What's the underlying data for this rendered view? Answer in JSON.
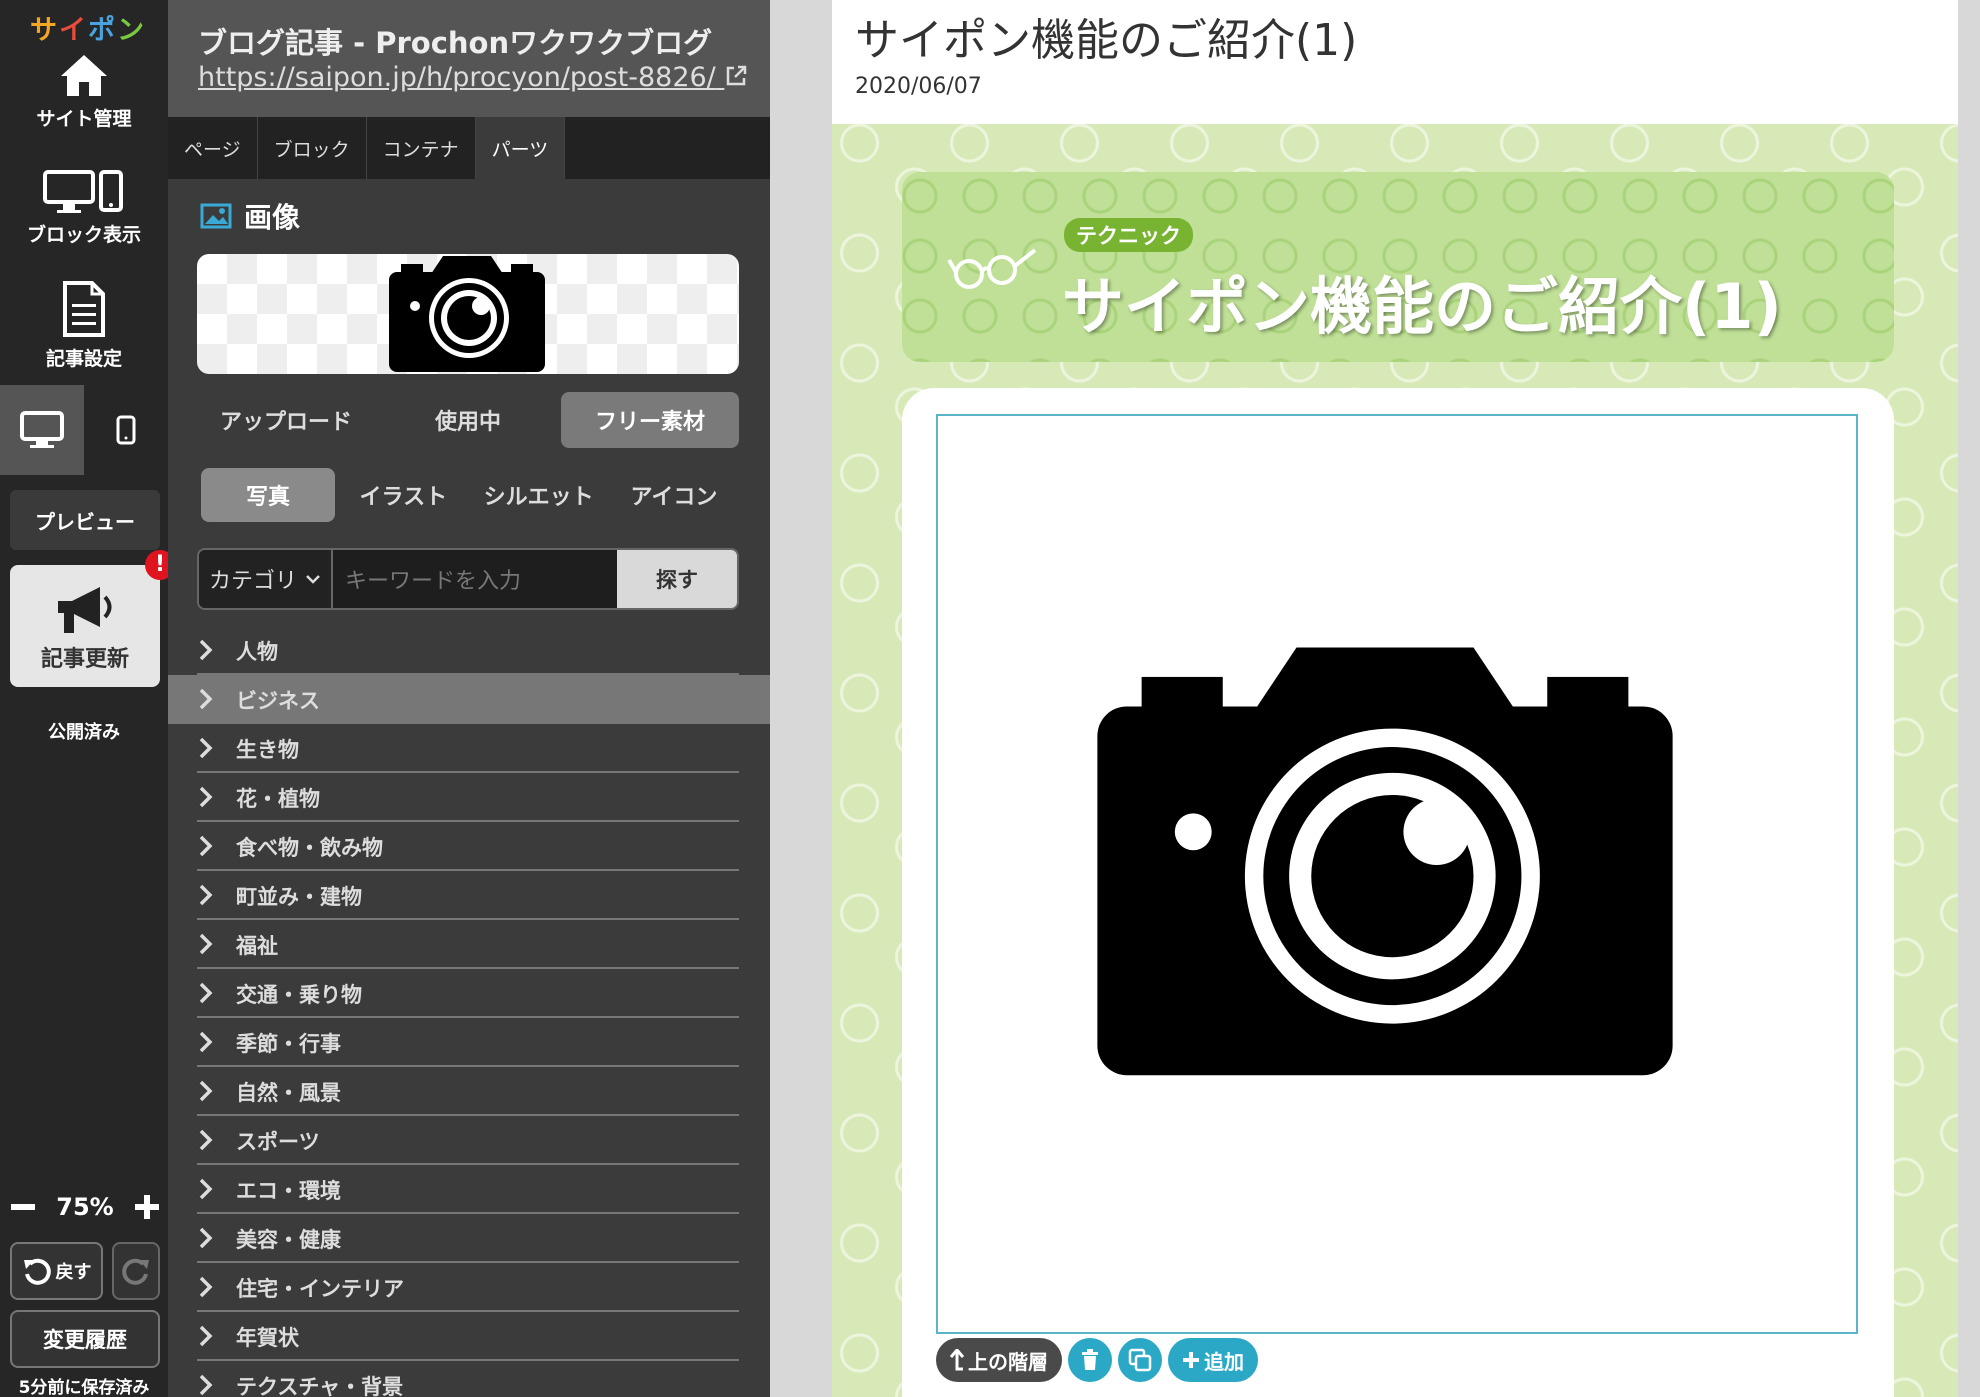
{
  "app": {
    "logo": [
      "サ",
      "イ",
      "ポ",
      "ン"
    ],
    "logo_colors": [
      "#f5a623",
      "#e94b3c",
      "#4aa3df",
      "#7ac943"
    ]
  },
  "rail": {
    "site_admin": "サイト管理",
    "block_view": "ブロック表示",
    "article_settings": "記事設定",
    "preview": "プレビュー",
    "update": "記事更新",
    "alert": "!",
    "published": "公開済み",
    "zoom": "75%",
    "undo": "戻す",
    "history": "変更履歴",
    "saved": "5分前に保存済み"
  },
  "panel": {
    "title": "ブログ記事 - Prochonワクワクブログ",
    "url": "https://saipon.jp/h/procyon/post-8826/",
    "tabs": [
      "ページ",
      "ブロック",
      "コンテナ",
      "パーツ"
    ],
    "active_tab": 3,
    "section": "画像",
    "source_tabs": [
      "アップロード",
      "使用中",
      "フリー素材"
    ],
    "active_source": 2,
    "type_tabs": [
      "写真",
      "イラスト",
      "シルエット",
      "アイコン"
    ],
    "active_type": 0,
    "category_select": "カテゴリ",
    "keyword_placeholder": "キーワードを入力",
    "search_button": "探す",
    "categories": [
      "人物",
      "ビジネス",
      "生き物",
      "花・植物",
      "食べ物・飲み物",
      "町並み・建物",
      "福祉",
      "交通・乗り物",
      "季節・行事",
      "自然・風景",
      "スポーツ",
      "エコ・環境",
      "美容・健康",
      "住宅・インテリア",
      "年賀状",
      "テクスチャ・背景"
    ],
    "highlighted_category": 1
  },
  "preview": {
    "title": "サイポン機能のご紹介(1)",
    "date": "2020/06/07",
    "badge": "テクニック",
    "banner_heading": "サイポン機能のご紹介(1)",
    "toolbar_up": "上の階層",
    "toolbar_add": "追加",
    "accent": "#2aa8c6",
    "bg_green": "#d7e9b6"
  }
}
